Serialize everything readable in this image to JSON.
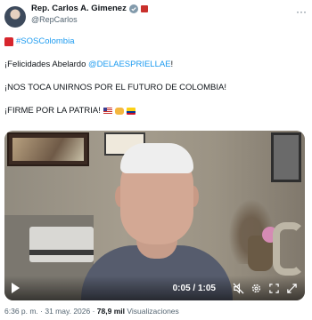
{
  "author": {
    "display_name": "Rep. Carlos A. Gimenez",
    "handle": "@RepCarlos"
  },
  "tweet": {
    "hashtag": "#SOSColombia",
    "line1_prefix": "¡Felicidades Abelardo ",
    "mention": "@DELAESPRIELLAE",
    "line1_suffix": "!",
    "line2": "¡NOS TOCA UNIRNOS POR EL FUTURO DE COLOMBIA!",
    "line3": "¡FIRME POR LA PATRIA!"
  },
  "video": {
    "time": "0:05 / 1:05"
  },
  "meta": {
    "timestamp": "6:36 p. m. · 31 may. 2026",
    "separator": " · ",
    "views_count": "78,9 mil",
    "views_label": " Visualizaciones"
  },
  "colors": {
    "link": "#1d9bf0",
    "secondary_text": "#536471"
  }
}
